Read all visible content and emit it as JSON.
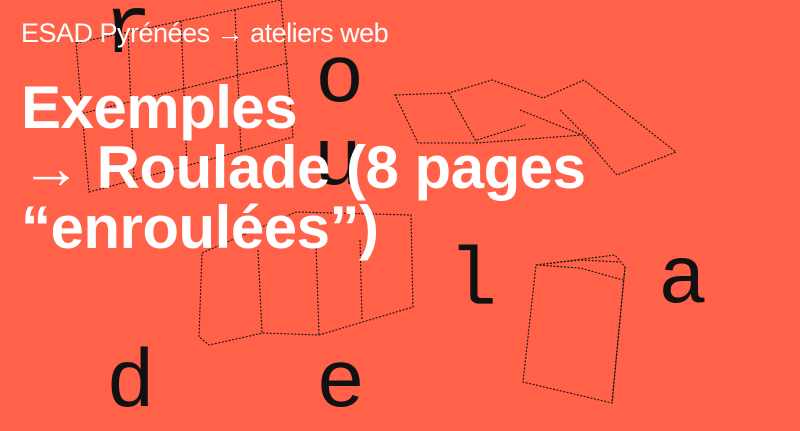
{
  "header": {
    "subtitle": "ESAD Pyrénées → ateliers web"
  },
  "title": {
    "lines": [
      "Exemples",
      "→ Roulade (8 pages",
      "“enroulées”)"
    ]
  },
  "decor_letters": [
    "r",
    "o",
    "u",
    "l",
    "a",
    "d",
    "e"
  ],
  "colors": {
    "background": "#ff6248",
    "title": "#ffffff",
    "letters": "#111111"
  }
}
